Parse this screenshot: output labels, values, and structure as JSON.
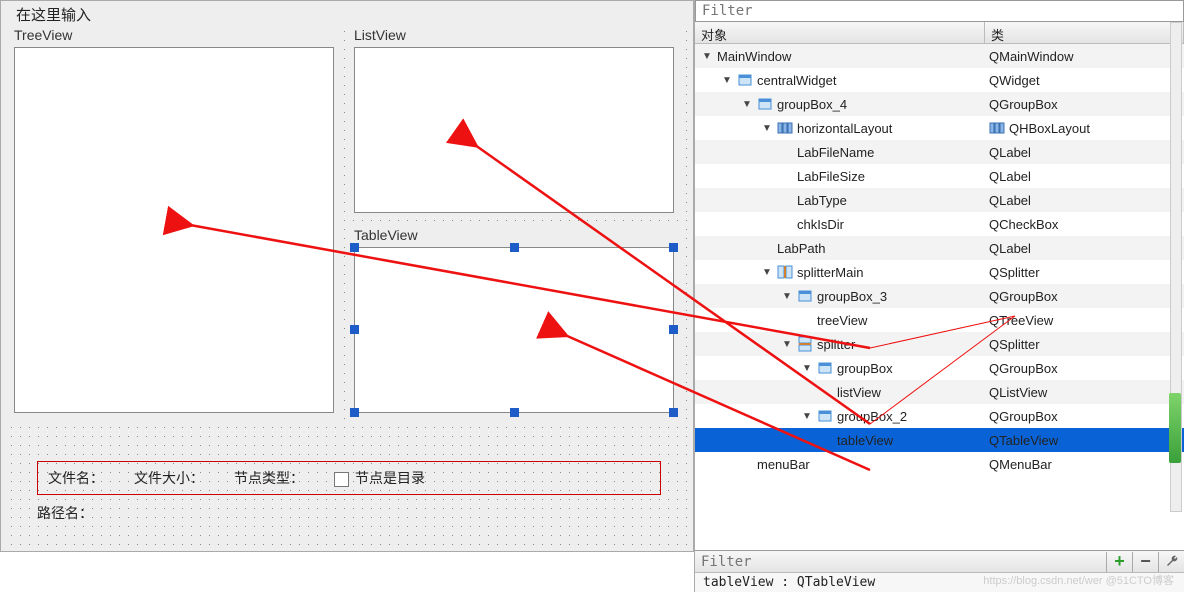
{
  "designer": {
    "top_hint": "在这里输入",
    "panes": {
      "tree": "TreeView",
      "list": "ListView",
      "table": "TableView"
    },
    "info": {
      "filename_label": "文件名：",
      "filesize_label": "文件大小：",
      "nodetype_label": "节点类型：",
      "isdir_label": "节点是目录",
      "path_label": "路径名："
    }
  },
  "inspector": {
    "filter_placeholder": "Filter",
    "columns": {
      "object": "对象",
      "class": "类"
    },
    "rows": [
      {
        "depth": 0,
        "exp": "open",
        "icon": "",
        "name": "MainWindow",
        "cls": "QMainWindow",
        "clsIcon": ""
      },
      {
        "depth": 1,
        "exp": "open",
        "icon": "widget",
        "name": "centralWidget",
        "cls": "QWidget",
        "clsIcon": ""
      },
      {
        "depth": 2,
        "exp": "open",
        "icon": "widget",
        "name": "groupBox_4",
        "cls": "QGroupBox",
        "clsIcon": ""
      },
      {
        "depth": 3,
        "exp": "open",
        "icon": "hlayout",
        "name": "horizontalLayout",
        "cls": "QHBoxLayout",
        "clsIcon": "hlayout"
      },
      {
        "depth": 4,
        "exp": "",
        "icon": "",
        "name": "LabFileName",
        "cls": "QLabel",
        "clsIcon": ""
      },
      {
        "depth": 4,
        "exp": "",
        "icon": "",
        "name": "LabFileSize",
        "cls": "QLabel",
        "clsIcon": ""
      },
      {
        "depth": 4,
        "exp": "",
        "icon": "",
        "name": "LabType",
        "cls": "QLabel",
        "clsIcon": ""
      },
      {
        "depth": 4,
        "exp": "",
        "icon": "",
        "name": "chkIsDir",
        "cls": "QCheckBox",
        "clsIcon": ""
      },
      {
        "depth": 3,
        "exp": "",
        "icon": "",
        "name": "LabPath",
        "cls": "QLabel",
        "clsIcon": ""
      },
      {
        "depth": 3,
        "exp": "open",
        "icon": "splitter",
        "name": "splitterMain",
        "cls": "QSplitter",
        "clsIcon": ""
      },
      {
        "depth": 4,
        "exp": "open",
        "icon": "widget",
        "name": "groupBox_3",
        "cls": "QGroupBox",
        "clsIcon": ""
      },
      {
        "depth": 5,
        "exp": "",
        "icon": "",
        "name": "treeView",
        "cls": "QTreeView",
        "clsIcon": ""
      },
      {
        "depth": 4,
        "exp": "open",
        "icon": "splitterv",
        "name": "splitter",
        "cls": "QSplitter",
        "clsIcon": ""
      },
      {
        "depth": 5,
        "exp": "open",
        "icon": "widget",
        "name": "groupBox",
        "cls": "QGroupBox",
        "clsIcon": ""
      },
      {
        "depth": 6,
        "exp": "",
        "icon": "",
        "name": "listView",
        "cls": "QListView",
        "clsIcon": ""
      },
      {
        "depth": 5,
        "exp": "open",
        "icon": "widget",
        "name": "groupBox_2",
        "cls": "QGroupBox",
        "clsIcon": ""
      },
      {
        "depth": 6,
        "exp": "",
        "icon": "",
        "name": "tableView",
        "cls": "QTableView",
        "clsIcon": "",
        "selected": true
      },
      {
        "depth": 2,
        "exp": "",
        "icon": "",
        "name": "menuBar",
        "cls": "QMenuBar",
        "clsIcon": ""
      }
    ],
    "add_tooltip": "+",
    "remove_tooltip": "−",
    "status": "tableView : QTableView"
  },
  "watermark": "https://blog.csdn.net/wer @51CTO博客"
}
